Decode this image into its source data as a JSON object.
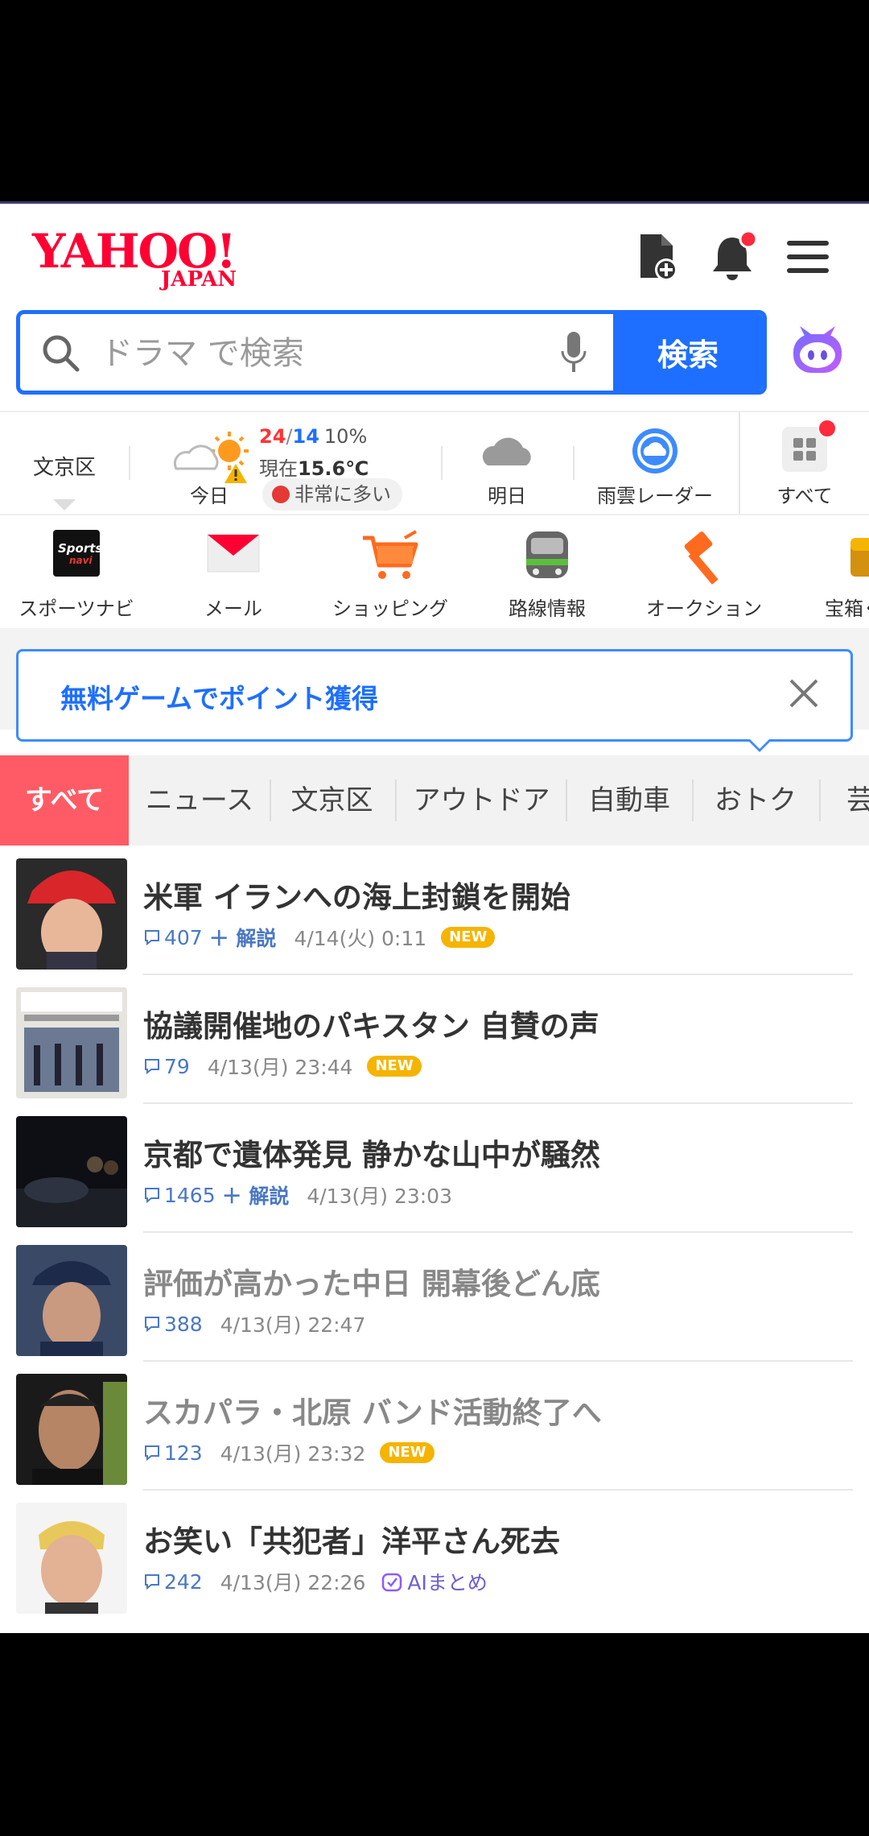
{
  "header": {
    "logo_main": "YAHOO!",
    "logo_sub": "JAPAN"
  },
  "search": {
    "placeholder": "ドラマ で検索",
    "button_label": "検索"
  },
  "weather": {
    "location": "文京区",
    "today": {
      "high": "24",
      "low": "14",
      "rain": "10%",
      "now_label": "現在",
      "now_temp": "15.6℃",
      "label": "今日",
      "pollen": "非常に多い"
    },
    "tomorrow_label": "明日",
    "radar_label": "雨雲レーダー",
    "all_label": "すべて"
  },
  "services": [
    {
      "label": "スポーツナビ",
      "icon": "sportsnavi-icon"
    },
    {
      "label": "メール",
      "icon": "mail-icon"
    },
    {
      "label": "ショッピング",
      "icon": "shopping-cart-icon"
    },
    {
      "label": "路線情報",
      "icon": "train-icon"
    },
    {
      "label": "オークション",
      "icon": "auction-hammer-icon"
    },
    {
      "label": "宝箱く",
      "icon": "treasure-box-icon"
    }
  ],
  "promo": {
    "text": "無料ゲームでポイント獲得"
  },
  "tabs": [
    "すべて",
    "ニュース",
    "文京区",
    "アウトドア",
    "自動車",
    "おトク",
    "芸"
  ],
  "news": [
    {
      "title": "米軍 イランへの海上封鎖を開始",
      "comments": "407",
      "explain": "＋ 解説",
      "time": "4/14(火) 0:11",
      "badge": "NEW",
      "read": false
    },
    {
      "title": "協議開催地のパキスタン 自賛の声",
      "comments": "79",
      "explain": "",
      "time": "4/13(月) 23:44",
      "badge": "NEW",
      "read": false
    },
    {
      "title": "京都で遺体発見 静かな山中が騒然",
      "comments": "1465",
      "explain": "＋ 解説",
      "time": "4/13(月) 23:03",
      "badge": "",
      "read": false
    },
    {
      "title": "評価が高かった中日 開幕後どん底",
      "comments": "388",
      "explain": "",
      "time": "4/13(月) 22:47",
      "badge": "",
      "read": true
    },
    {
      "title": "スカパラ・北原 バンド活動終了へ",
      "comments": "123",
      "explain": "",
      "time": "4/13(月) 23:32",
      "badge": "NEW",
      "read": true
    },
    {
      "title": "お笑い「共犯者」洋平さん死去",
      "comments": "242",
      "explain": "",
      "time": "4/13(月) 22:26",
      "badge": "",
      "ai": "AIまとめ",
      "read": false
    }
  ],
  "colors": {
    "brand_red": "#ff0033",
    "accent_blue": "#1e6fff",
    "tab_active": "#ff5b66",
    "new_badge": "#f5b400"
  }
}
